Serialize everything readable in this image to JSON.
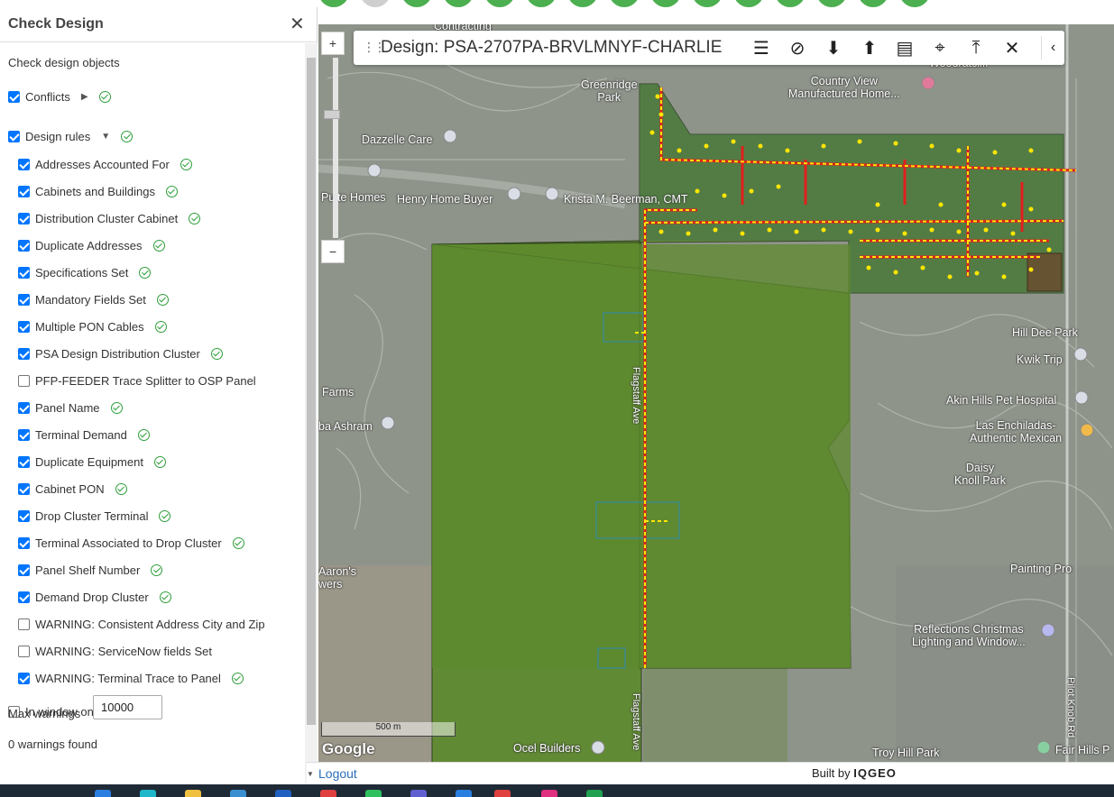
{
  "panel": {
    "title": "Check Design",
    "close_icon": "close-icon",
    "subtitle": "Check design objects",
    "conflicts": {
      "label": "Conflicts",
      "checked": true,
      "status": "ok"
    },
    "design_rules": {
      "label": "Design rules",
      "checked": true,
      "status": "ok"
    },
    "rules": [
      {
        "label": "Addresses Accounted For",
        "checked": true,
        "status": "ok"
      },
      {
        "label": "Cabinets and Buildings",
        "checked": true,
        "status": "ok"
      },
      {
        "label": "Distribution Cluster Cabinet",
        "checked": true,
        "status": "ok"
      },
      {
        "label": "Duplicate Addresses",
        "checked": true,
        "status": "ok"
      },
      {
        "label": "Specifications Set",
        "checked": true,
        "status": "ok"
      },
      {
        "label": "Mandatory Fields Set",
        "checked": true,
        "status": "ok"
      },
      {
        "label": "Multiple PON Cables",
        "checked": true,
        "status": "ok"
      },
      {
        "label": "PSA Design Distribution Cluster",
        "checked": true,
        "status": "ok"
      },
      {
        "label": "PFP-FEEDER Trace Splitter to OSP Panel",
        "checked": false,
        "status": ""
      },
      {
        "label": "Panel Name",
        "checked": true,
        "status": "ok"
      },
      {
        "label": "Terminal Demand",
        "checked": true,
        "status": "ok"
      },
      {
        "label": "Duplicate Equipment",
        "checked": true,
        "status": "ok"
      },
      {
        "label": "Cabinet PON",
        "checked": true,
        "status": "ok"
      },
      {
        "label": "Drop Cluster Terminal",
        "checked": true,
        "status": "ok"
      },
      {
        "label": "Terminal Associated to Drop Cluster",
        "checked": true,
        "status": "ok"
      },
      {
        "label": "Panel Shelf Number",
        "checked": true,
        "status": "ok"
      },
      {
        "label": "Demand Drop Cluster",
        "checked": true,
        "status": "ok"
      },
      {
        "label": "WARNING: Consistent Address City and Zip",
        "checked": false,
        "status": ""
      },
      {
        "label": "WARNING: ServiceNow fields Set",
        "checked": false,
        "status": ""
      },
      {
        "label": "WARNING: Terminal Trace to Panel",
        "checked": true,
        "status": "ok"
      }
    ],
    "in_window_only": {
      "label": "In window only",
      "checked": false
    },
    "max_warnings_label": "Max warnings",
    "max_warnings_value": "10000",
    "warnings_found": "0 warnings found"
  },
  "design_toolbar": {
    "title": "Design: PSA-2707PA-BRVLMNYF-CHARLIE",
    "icons": [
      "list-icon",
      "block-icon",
      "arrow-down-icon",
      "arrow-up-icon",
      "details-icon",
      "crosshair-icon",
      "upload-icon",
      "close-icon",
      "collapse-icon"
    ]
  },
  "map": {
    "zoom_in": "+",
    "zoom_out": "−",
    "scale_label": "500 m",
    "attribution": "Google",
    "labels": {
      "greenridge": "Greenridge\nPark",
      "country_view": "Country View\nManufactured Home...",
      "dazzelle": "Dazzelle Care",
      "pulte": "Pulte Homes",
      "henry": "Henry Home Buyer",
      "krista": "Krista M. Beerman, CMT",
      "hill_dee": "Hill Dee Park",
      "kwik": "Kwik Trip",
      "akin": "Akin Hills Pet Hospital",
      "las_enchiladas": "Las Enchiladas-\nAuthentic Mexican",
      "daisy": "Daisy\nKnoll Park",
      "farms": "Farms",
      "ashram": "ba Ashram",
      "aarons": "Aaron's\nwers",
      "painting": "Painting Pro",
      "reflections": "Reflections Christmas\nLighting and Window...",
      "ocel": "Ocel Builders",
      "troy": "Troy Hill Park",
      "fair": "Fair Hills P",
      "flagstaff": "Flagstaff Ave",
      "pilot": "Pilot Knob Rd",
      "contracting": "Contracting",
      "woodrat": "Woodratcliff"
    }
  },
  "footer": {
    "logout": "Logout",
    "built_by": "Built by",
    "brand": "IQGEO"
  },
  "colors": {
    "accent_green": "#4caf50",
    "checkbox_blue": "#0075ff",
    "ok_green": "#2e9e3a",
    "cable_red": "#e0201c",
    "drop_yellow": "#ffe600",
    "area_green": "#5e8a2e"
  }
}
